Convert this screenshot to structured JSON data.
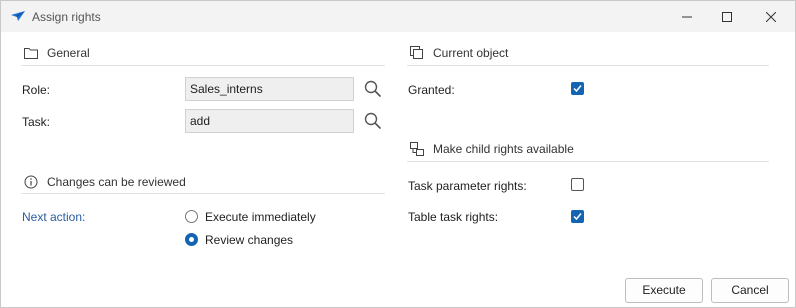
{
  "window": {
    "title": "Assign rights"
  },
  "general": {
    "heading": "General",
    "role_label": "Role:",
    "role_value": "Sales_interns",
    "task_label": "Task:",
    "task_value": "add"
  },
  "review": {
    "heading": "Changes can be reviewed",
    "next_action_label": "Next action:",
    "options": [
      "Execute immediately",
      "Review changes"
    ],
    "selected": "Review changes"
  },
  "current_object": {
    "heading": "Current object",
    "granted_label": "Granted:",
    "granted": true
  },
  "child_rights": {
    "heading": "Make child rights available",
    "task_param_label": "Task parameter rights:",
    "task_param": false,
    "table_task_label": "Table task rights:",
    "table_task": true
  },
  "buttons": {
    "execute": "Execute",
    "cancel": "Cancel"
  },
  "colors": {
    "accent": "#1464b4",
    "label_accent": "#2a5d9f"
  }
}
